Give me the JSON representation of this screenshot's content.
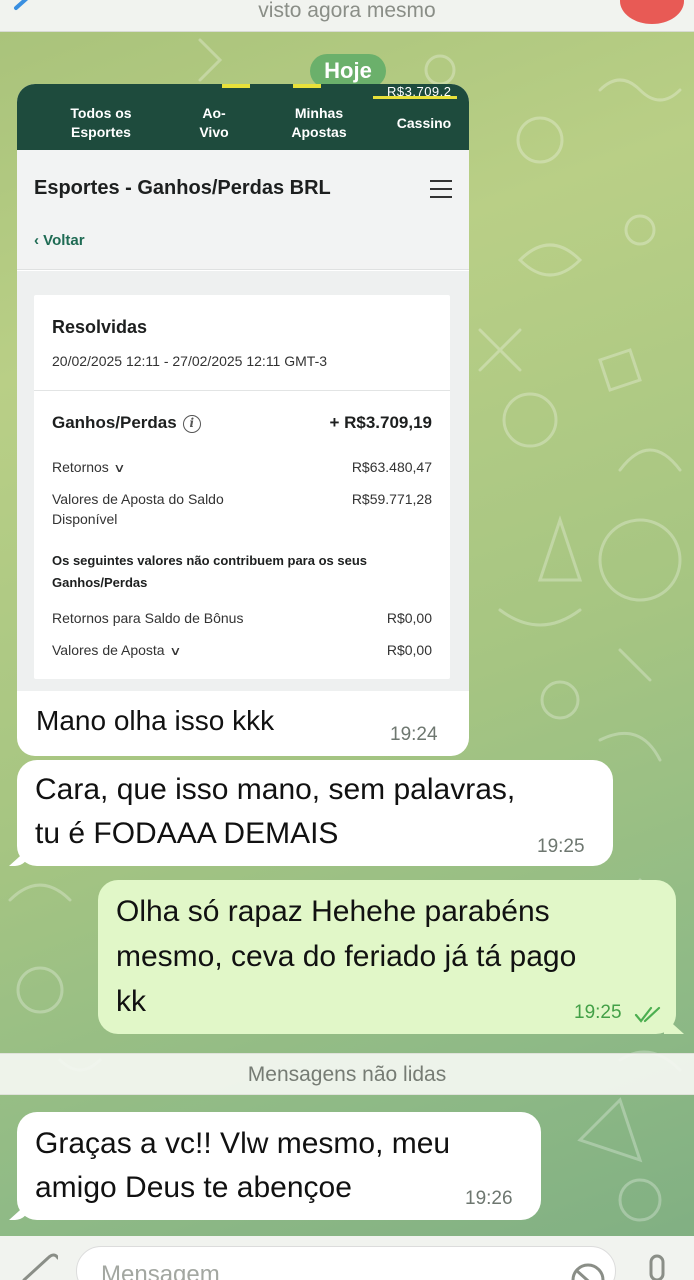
{
  "header": {
    "status": "visto agora mesmo"
  },
  "date_pill": "Hoje",
  "screenshot": {
    "nav_peek": "R$3.709,2",
    "nav": [
      "Todos os Esportes",
      "Ao-Vivo",
      "Minhas Apostas",
      "Cassino"
    ],
    "nav_lines": [
      [
        "Todos os",
        "Esportes"
      ],
      [
        "Ao-",
        "Vivo"
      ],
      [
        "Minhas",
        "Apostas"
      ],
      [
        "Cassino"
      ]
    ],
    "page_title": "Esportes - Ganhos/Perdas BRL",
    "back_label": "Voltar",
    "section_title": "Resolvidas",
    "date_range": "20/02/2025 12:11 - 27/02/2025 12:11 GMT-3",
    "gains_label": "Ganhos/Perdas",
    "gains_value": "+ R$3.709,19",
    "returns_label": "Retornos",
    "returns_value": "R$63.480,47",
    "stake_label_1": "Valores de Aposta do Saldo",
    "stake_label_2": "Disponível",
    "stake_value": "R$59.771,28",
    "note": "Os seguintes valores não contribuem para os seus Ganhos/Perdas",
    "bonus_returns_label": "Retornos para Saldo de Bônus",
    "bonus_returns_value": "R$0,00",
    "bet_values_label": "Valores de Aposta",
    "bet_values_value": "R$0,00"
  },
  "messages": [
    {
      "direction": "in",
      "lines": [
        "Mano olha isso kkk"
      ],
      "time": "19:24"
    },
    {
      "direction": "in",
      "lines": [
        "Cara, que isso mano, sem palavras,",
        "tu é FODAAA DEMAIS"
      ],
      "time": "19:25"
    },
    {
      "direction": "out",
      "lines": [
        "Olha só rapaz Hehehe parabéns",
        "mesmo, ceva do feriado já tá pago",
        "kk"
      ],
      "time": "19:25",
      "read": true
    },
    {
      "direction": "in",
      "lines": [
        "Graças a vc!! Vlw mesmo, meu",
        "amigo Deus te abençoe"
      ],
      "time": "19:26"
    }
  ],
  "unread_divider": "Mensagens não lidas",
  "composer": {
    "placeholder": "Mensagem"
  },
  "colors": {
    "app_nav": "#1e4b3d",
    "accent_yellow": "#e8e13a",
    "outgoing_bubble": "#e1f7c8",
    "read_check": "#4caf50"
  },
  "icons": [
    "back-arrow-icon",
    "info-icon",
    "chevron-down-icon",
    "menu-icon",
    "attach-icon",
    "sticker-icon",
    "mic-icon",
    "double-check-icon"
  ]
}
